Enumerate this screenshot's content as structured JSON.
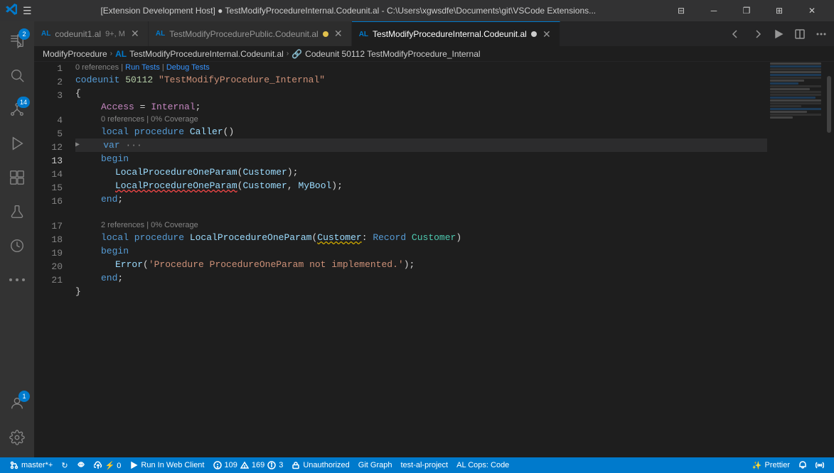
{
  "titleBar": {
    "icon": "⌨",
    "title": "[Extension Development Host] ● TestModifyProcedureInternal.Codeunit.al - C:\\Users\\xgwsdfe\\Documents\\git\\VSCode Extensions...",
    "controls": {
      "minimize": "─",
      "maximize": "□",
      "restore": "⧉",
      "layout": "⊞",
      "close": "✕"
    }
  },
  "activityBar": {
    "items": [
      {
        "id": "explorer",
        "icon": "⎘",
        "badge": "2",
        "active": false
      },
      {
        "id": "git",
        "icon": "⎇",
        "badge": "14",
        "active": false
      },
      {
        "id": "run",
        "icon": "▷",
        "badge": null,
        "active": false
      },
      {
        "id": "extensions",
        "icon": "⊞",
        "badge": null,
        "active": false
      },
      {
        "id": "test",
        "icon": "⚗",
        "badge": null,
        "active": false
      },
      {
        "id": "history",
        "icon": "◷",
        "badge": null,
        "active": false
      },
      {
        "id": "more",
        "icon": "•••",
        "badge": null,
        "active": false
      }
    ],
    "bottom": [
      {
        "id": "account",
        "icon": "👤",
        "badge": "1"
      },
      {
        "id": "settings",
        "icon": "⚙",
        "badge": null
      }
    ]
  },
  "tabs": [
    {
      "id": "codeunit1",
      "lang": "AL",
      "name": "codeunit1.al",
      "suffix": "9+, M",
      "dirty": false,
      "active": false,
      "hasDot": false
    },
    {
      "id": "modifyPublic",
      "lang": "AL",
      "name": "TestModifyProcedurePublic.Codeunit.al",
      "dirty": true,
      "active": false,
      "hasDot": true
    },
    {
      "id": "modifyInternal",
      "lang": "AL",
      "name": "TestModifyProcedureInternal.Codeunit.al",
      "dirty": true,
      "active": true,
      "hasDot": false
    }
  ],
  "tabActions": [
    "←",
    "→",
    "⊕",
    "⊟",
    "≡"
  ],
  "breadcrumb": {
    "parts": [
      {
        "text": "ModifyProcedure",
        "isLang": false
      },
      {
        "sep": "›"
      },
      {
        "text": "AL",
        "isLang": true
      },
      {
        "text": "TestModifyProcedureInternal.Codeunit.al",
        "isLang": false
      },
      {
        "sep": "›"
      },
      {
        "text": "🔗",
        "isIcon": true
      },
      {
        "text": "Codeunit 50112 TestModifyProcedure_Internal",
        "isLang": false
      }
    ]
  },
  "code": {
    "referencesLine0": "0 references | Run Tests | Debug Tests",
    "referencesLine1": "0 references | 0% Coverage",
    "referencesLine2": "2 references | 0% Coverage"
  },
  "statusBar": {
    "branch": "master*+",
    "syncIcon": "↻",
    "watchIcon": "👁",
    "cloudIcon": "⚡",
    "cloudCount": "0",
    "runLabel": "Run In Web Client",
    "errorIcon": "⊗",
    "errorCount": "109",
    "warnIcon": "⚠",
    "warnCount": "169",
    "infoIcon": "ℹ",
    "infoCount": "3",
    "lockIcon": "🔒",
    "unauthorized": "Unauthorized",
    "gitGraph": "Git Graph",
    "project": "test-al-project",
    "cops": "AL Cops: Code",
    "prettierIcon": "✨",
    "prettier": "Prettier",
    "bellIcon": "🔔",
    "personIcon": "👤"
  }
}
